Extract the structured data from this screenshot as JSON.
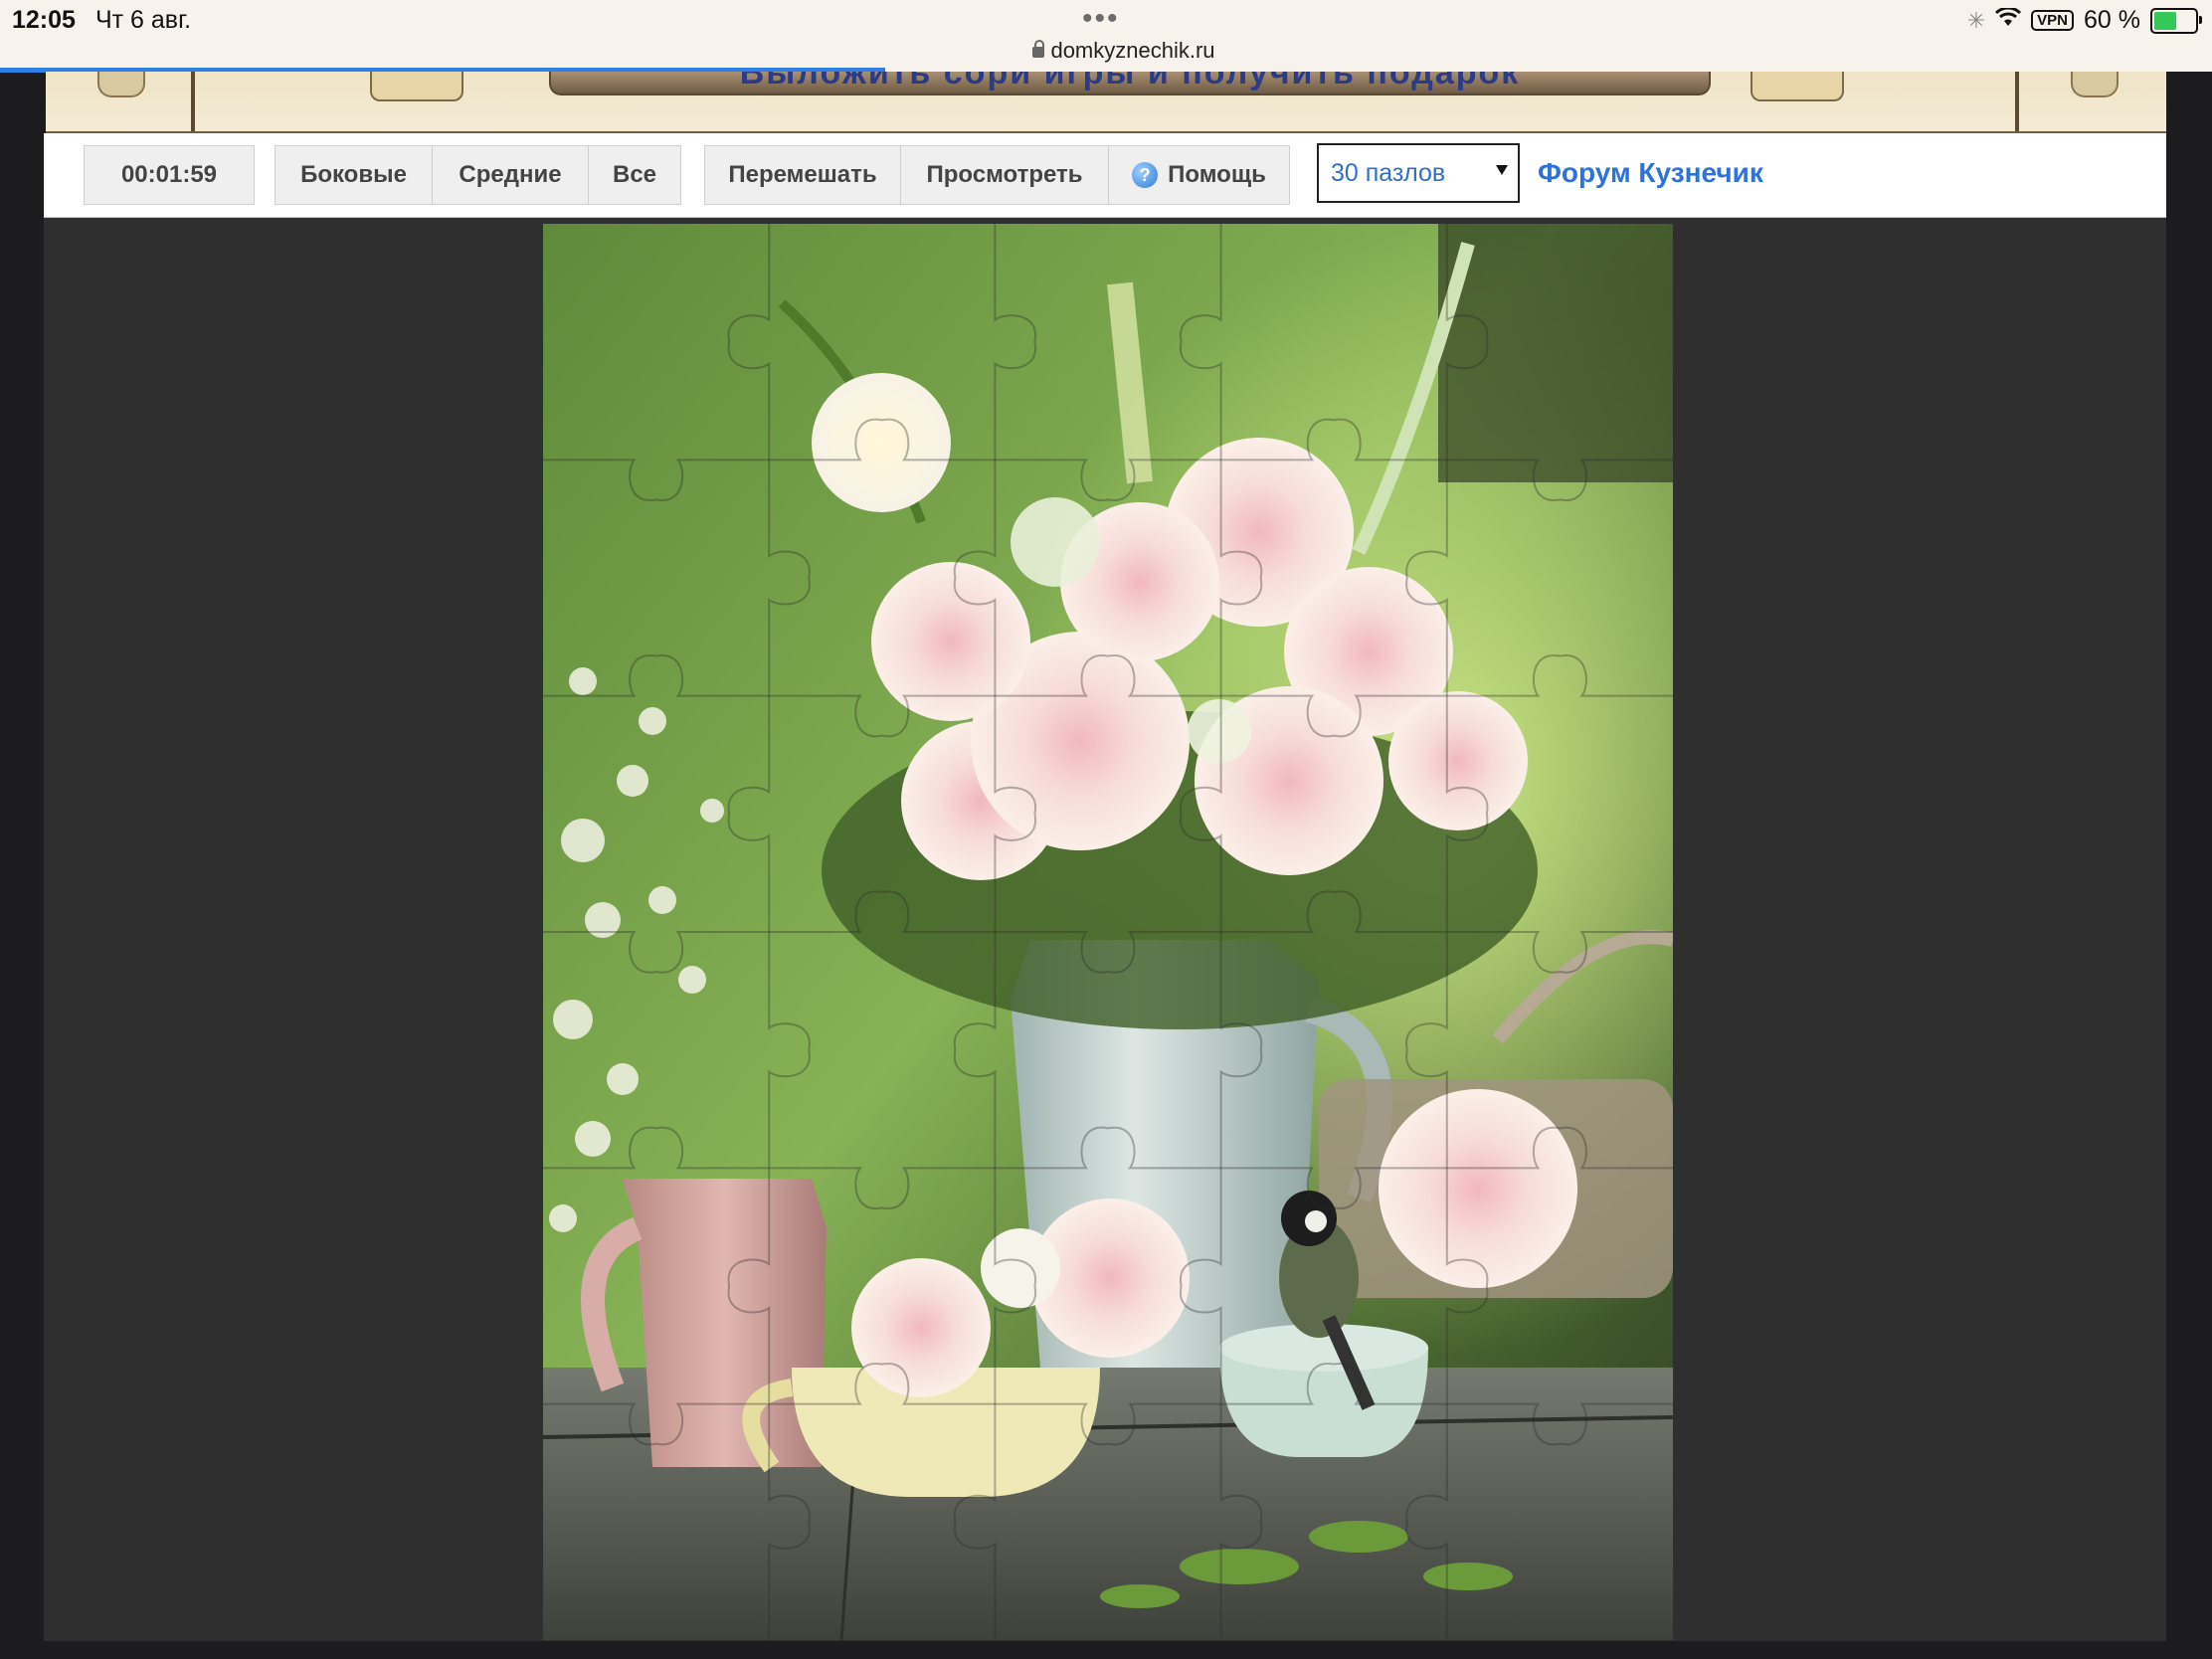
{
  "status_bar": {
    "time": "12:05",
    "date": "Чт 6 авг.",
    "url": "domkyznechik.ru",
    "vpn": "VPN",
    "battery": "60 %",
    "battery_level": 0.6,
    "page_load_progress": 0.4
  },
  "banner": {
    "text": "Выложить сори игры и получить подарок"
  },
  "toolbar": {
    "timer": "00:01:59",
    "side_label": "Боковые",
    "middle_label": "Средние",
    "all_label": "Все",
    "shuffle_label": "Перемешать",
    "preview_label": "Просмотреть",
    "help_label": "Помощь",
    "help_icon_glyph": "?",
    "pieces_select": "30 пазлов",
    "forum_link": "Форум Кузнечик"
  },
  "puzzle": {
    "columns": 5,
    "rows": 6,
    "image_description_icon": "flowers-photo",
    "colors": {
      "foliage_dark": "#2f4a1e",
      "foliage_light": "#8fbf4a",
      "peony": "#f6dcd8",
      "jug_pink": "#d9a6a0",
      "jug_blue": "#c7d3d3",
      "cup_yellow": "#efe9b8",
      "table": "#5e625a"
    }
  }
}
